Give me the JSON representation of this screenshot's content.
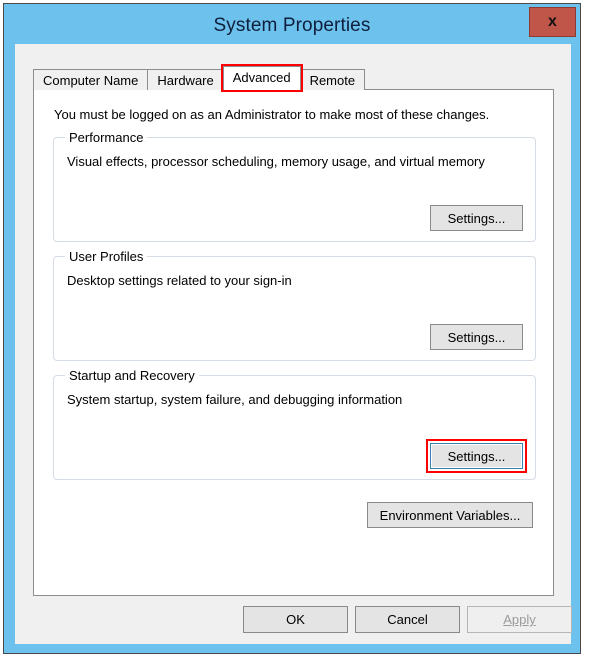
{
  "window": {
    "title": "System Properties",
    "close_label": "x",
    "close_icon": "close-icon",
    "frame_color": "#6cc2ec",
    "close_button_color": "#c0564a"
  },
  "tabs": [
    {
      "id": "computer-name",
      "label": "Computer Name",
      "active": false
    },
    {
      "id": "hardware",
      "label": "Hardware",
      "active": false
    },
    {
      "id": "advanced",
      "label": "Advanced",
      "active": true
    },
    {
      "id": "remote",
      "label": "Remote",
      "active": false
    }
  ],
  "annotations": {
    "color": "#ff0000",
    "targets": [
      "tab-advanced",
      "startup-recovery-settings-button"
    ]
  },
  "content": {
    "admin_note": "You must be logged on as an Administrator to make most of these changes.",
    "groups": [
      {
        "id": "performance",
        "title": "Performance",
        "description": "Visual effects, processor scheduling, memory usage, and virtual memory",
        "button_label": "Settings...",
        "highlighted": false,
        "focused": false
      },
      {
        "id": "user-profiles",
        "title": "User Profiles",
        "description": "Desktop settings related to your sign-in",
        "button_label": "Settings...",
        "highlighted": false,
        "focused": false
      },
      {
        "id": "startup-and-recovery",
        "title": "Startup and Recovery",
        "description": "System startup, system failure, and debugging information",
        "button_label": "Settings...",
        "highlighted": true,
        "focused": true
      }
    ],
    "environment_variables_label": "Environment Variables..."
  },
  "footer": {
    "ok_label": "OK",
    "cancel_label": "Cancel",
    "apply_label": "Apply",
    "apply_disabled": true
  }
}
